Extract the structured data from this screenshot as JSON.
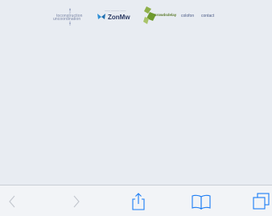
{
  "footer": {
    "logos": {
      "imagination": {
        "line1": "toconstruction",
        "line2": "uncoordination"
      },
      "zonmw": {
        "tagline": "—— ——— ——",
        "name": "ZonMw"
      },
      "green": {
        "brand": "crowdsdelay"
      }
    },
    "links": {
      "colofon": "colofon",
      "contact": "contact"
    }
  },
  "toolbar": {
    "back_icon": "chevron-left-icon",
    "forward_icon": "chevron-right-icon",
    "share_icon": "share-icon",
    "bookmarks_icon": "book-icon",
    "tabs_icon": "tabs-icon"
  },
  "colors": {
    "page_background": "#e8ecf2",
    "toolbar_background": "#f2f4f7",
    "icon_active": "#1a7cf5",
    "icon_disabled": "#c4c8cf"
  }
}
